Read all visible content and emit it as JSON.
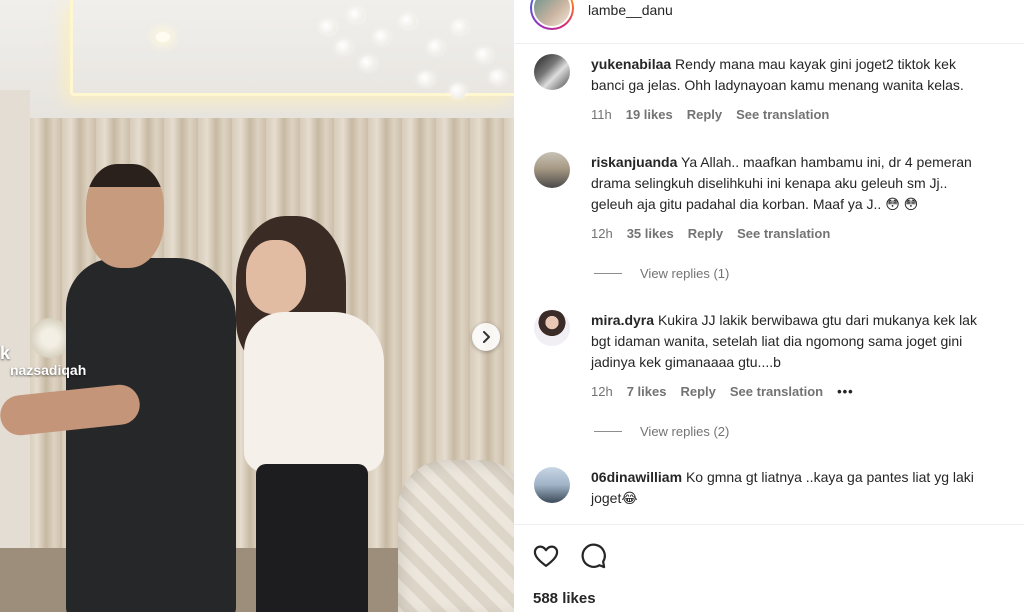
{
  "media": {
    "overlay_big": "k",
    "overlay_small": "nazsadiqah"
  },
  "header": {
    "username": "lambe__danu"
  },
  "comments": [
    {
      "username": "yukenabilaa",
      "lines": [
        "Rendy mana mau kayak gini joget2 tiktok kek",
        "banci ga jelas. Ohh ladynayoan kamu menang wanita kelas."
      ],
      "time": "11h",
      "likes": "19 likes",
      "reply": "Reply",
      "translate": "See translation"
    },
    {
      "username": "riskanjuanda",
      "lines": [
        "Ya Allah.. maafkan hambamu ini, dr 4 pemeran",
        "drama selingkuh diselihkuhi ini kenapa aku geleuh sm Jj..",
        "geleuh aja gitu padahal dia korban. Maaf ya J.. 😳 😳"
      ],
      "time": "12h",
      "likes": "35 likes",
      "reply": "Reply",
      "translate": "See translation",
      "view_replies": "View replies (1)"
    },
    {
      "username": "mira.dyra",
      "lines": [
        "Kukira JJ lakik berwibawa gtu dari mukanya kek lak",
        "bgt idaman wanita, setelah liat dia ngomong sama joget gini",
        "jadinya kek gimanaaaa gtu....b"
      ],
      "time": "12h",
      "likes": "7 likes",
      "reply": "Reply",
      "translate": "See translation",
      "more": "•••",
      "view_replies": "View replies (2)"
    },
    {
      "username": "06dinawilliam",
      "lines": [
        "Ko gmna gt liatnya ..kaya ga pantes liat yg laki",
        "joget😂"
      ]
    }
  ],
  "footer": {
    "likes_total": "588 likes"
  },
  "colors": {
    "text_primary": "#262626",
    "text_secondary": "#737373",
    "divider": "#efefef"
  },
  "icons": [
    "next-arrow-icon",
    "heart-icon",
    "comment-icon"
  ]
}
